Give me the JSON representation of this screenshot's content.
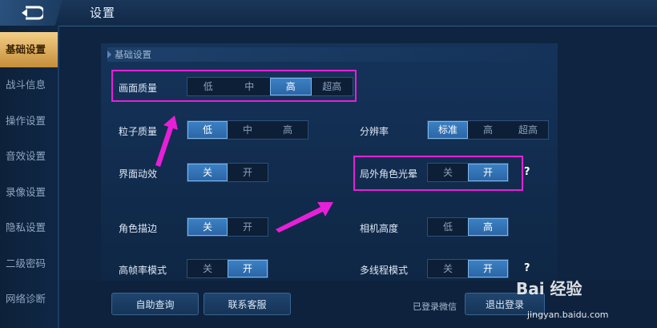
{
  "header": {
    "title": "设置"
  },
  "sidebar": {
    "items": [
      {
        "label": "基础设置",
        "active": true
      },
      {
        "label": "战斗信息"
      },
      {
        "label": "操作设置"
      },
      {
        "label": "音效设置"
      },
      {
        "label": "录像设置"
      },
      {
        "label": "隐私设置"
      },
      {
        "label": "二级密码"
      },
      {
        "label": "网络诊断"
      }
    ]
  },
  "section": {
    "title": "基础设置"
  },
  "settings": {
    "quality": {
      "label": "画面质量",
      "options": [
        "低",
        "中",
        "高",
        "超高"
      ],
      "selected": "高"
    },
    "particle": {
      "label": "粒子质量",
      "options": [
        "低",
        "中",
        "高"
      ],
      "selected": "低"
    },
    "resolution": {
      "label": "分辨率",
      "options": [
        "标准",
        "高",
        "超高"
      ],
      "selected": "标准"
    },
    "ui_fx": {
      "label": "界面动效",
      "options": [
        "关",
        "开"
      ],
      "selected": "关"
    },
    "halo": {
      "label": "局外角色光晕",
      "options": [
        "关",
        "开"
      ],
      "selected": "开",
      "help": "?"
    },
    "outline": {
      "label": "角色描边",
      "options": [
        "关",
        "开"
      ],
      "selected": "关"
    },
    "camera": {
      "label": "相机高度",
      "options": [
        "低",
        "高"
      ],
      "selected": "高"
    },
    "hfr": {
      "label": "高帧率模式",
      "options": [
        "关",
        "开"
      ],
      "selected": "开"
    },
    "multithread": {
      "label": "多线程模式",
      "options": [
        "关",
        "开"
      ],
      "selected": "开",
      "help": "?"
    }
  },
  "footer": {
    "self_help": "自助查询",
    "contact": "联系客服",
    "login_status": "已登录微信",
    "logout": "退出登录"
  },
  "watermark": {
    "brand": "Bai 经验",
    "url": "jingyan.baidu.com"
  },
  "colors": {
    "accent": "#e81fd8",
    "selected": "#2f6fb0",
    "active_tab": "#e0b05f"
  }
}
